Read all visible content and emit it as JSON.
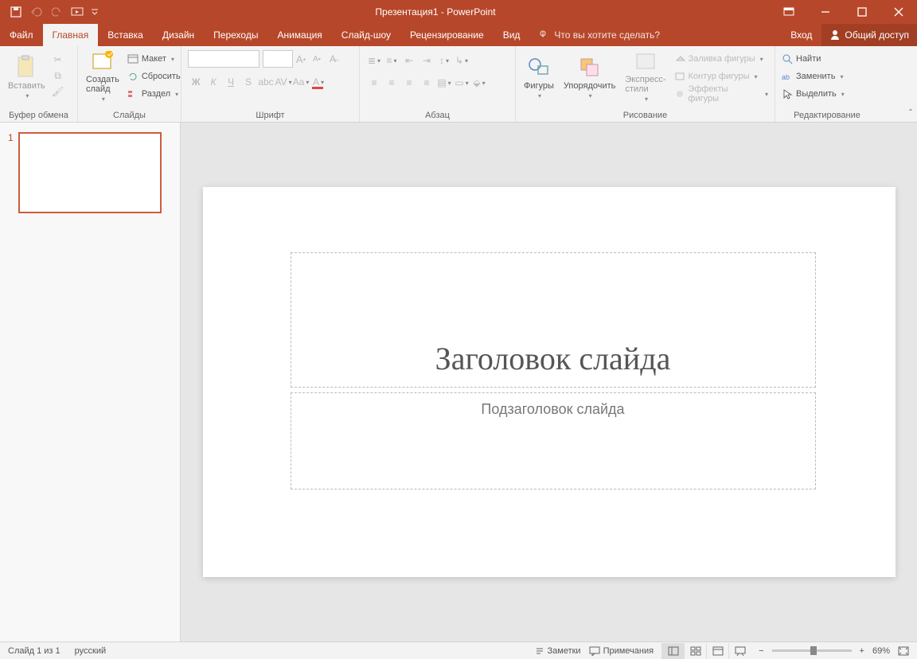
{
  "titlebar": {
    "title": "Презентация1 - PowerPoint"
  },
  "menu": {
    "file": "Файл",
    "home": "Главная",
    "insert": "Вставка",
    "design": "Дизайн",
    "transitions": "Переходы",
    "animations": "Анимация",
    "slideshow": "Слайд-шоу",
    "review": "Рецензирование",
    "view": "Вид",
    "tellme": "Что вы хотите сделать?",
    "signin": "Вход",
    "share": "Общий доступ"
  },
  "ribbon": {
    "clipboard": {
      "label": "Буфер обмена",
      "paste": "Вставить"
    },
    "slides": {
      "label": "Слайды",
      "new": "Создать\nслайд",
      "layout": "Макет",
      "reset": "Сбросить",
      "section": "Раздел"
    },
    "font": {
      "label": "Шрифт"
    },
    "paragraph": {
      "label": "Абзац"
    },
    "drawing": {
      "label": "Рисование",
      "shapes": "Фигуры",
      "arrange": "Упорядочить",
      "styles": "Экспресс-\nстили",
      "fill": "Заливка фигуры",
      "outline": "Контур фигуры",
      "effects": "Эффекты фигуры"
    },
    "editing": {
      "label": "Редактирование",
      "find": "Найти",
      "replace": "Заменить",
      "select": "Выделить"
    }
  },
  "slide": {
    "title_placeholder": "Заголовок слайда",
    "subtitle_placeholder": "Подзаголовок слайда",
    "thumb_number": "1"
  },
  "statusbar": {
    "slide_info": "Слайд 1 из 1",
    "language": "русский",
    "notes": "Заметки",
    "comments": "Примечания",
    "zoom": "69%"
  }
}
